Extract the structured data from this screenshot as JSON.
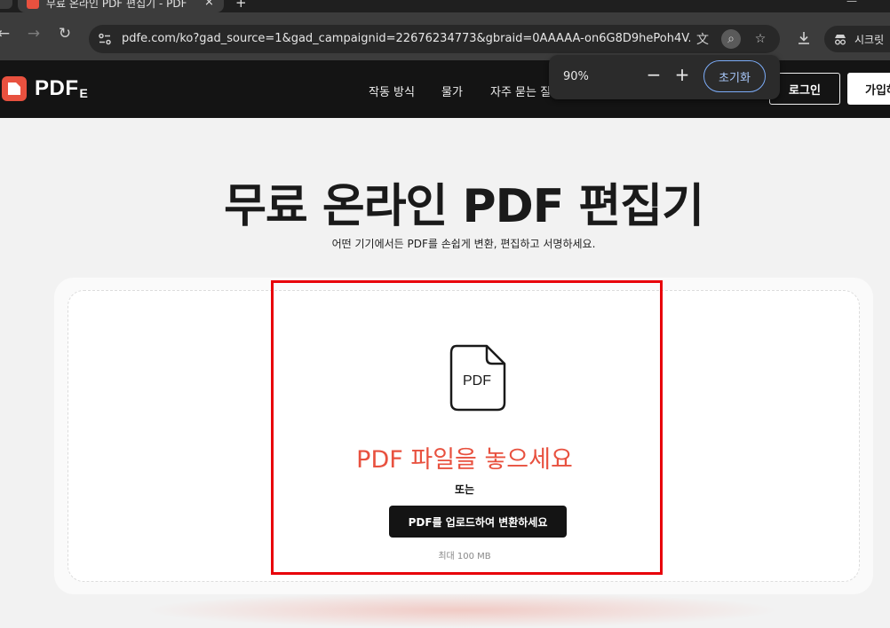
{
  "browser": {
    "tab_title": "무료 온라인 PDF 편집기 - PDF",
    "tab_close": "×",
    "new_tab": "+",
    "url": "pdfe.com/ko?gad_source=1&gad_campaignid=22676234773&gbraid=0AAAAA-on6G8D9hePoh4V...",
    "incognito_label": "시크릿",
    "back_glyph": "←",
    "forward_glyph": "→",
    "reload_glyph": "↻",
    "bookmark_glyph": "☆",
    "translate_glyph": "文",
    "zoom_glyph": "⌕"
  },
  "zoom_popup": {
    "value": "90%",
    "minus": "−",
    "plus": "+",
    "reset_label": "초기화"
  },
  "site": {
    "logo_text": "PDF",
    "logo_suffix": "E",
    "nav": [
      "작동 방식",
      "물가",
      "자주 묻는 질"
    ],
    "login_label": "로그인",
    "signup_label": "가입하"
  },
  "hero": {
    "title": "무료 온라인 PDF 편집기",
    "subtitle": "어떤 기기에서든 PDF를 손쉽게 변환, 편집하고 서명하세요."
  },
  "upload": {
    "icon_label": "PDF",
    "drop_text": "PDF 파일을 놓으세요",
    "or_text": "또는",
    "button_label": "PDF를 업로드하여 변환하세요",
    "max_size": "최대 100 MB"
  },
  "colors": {
    "brand": "#e8513f",
    "annotation": "#e8000a",
    "zoom_accent": "#a8c7fa"
  }
}
